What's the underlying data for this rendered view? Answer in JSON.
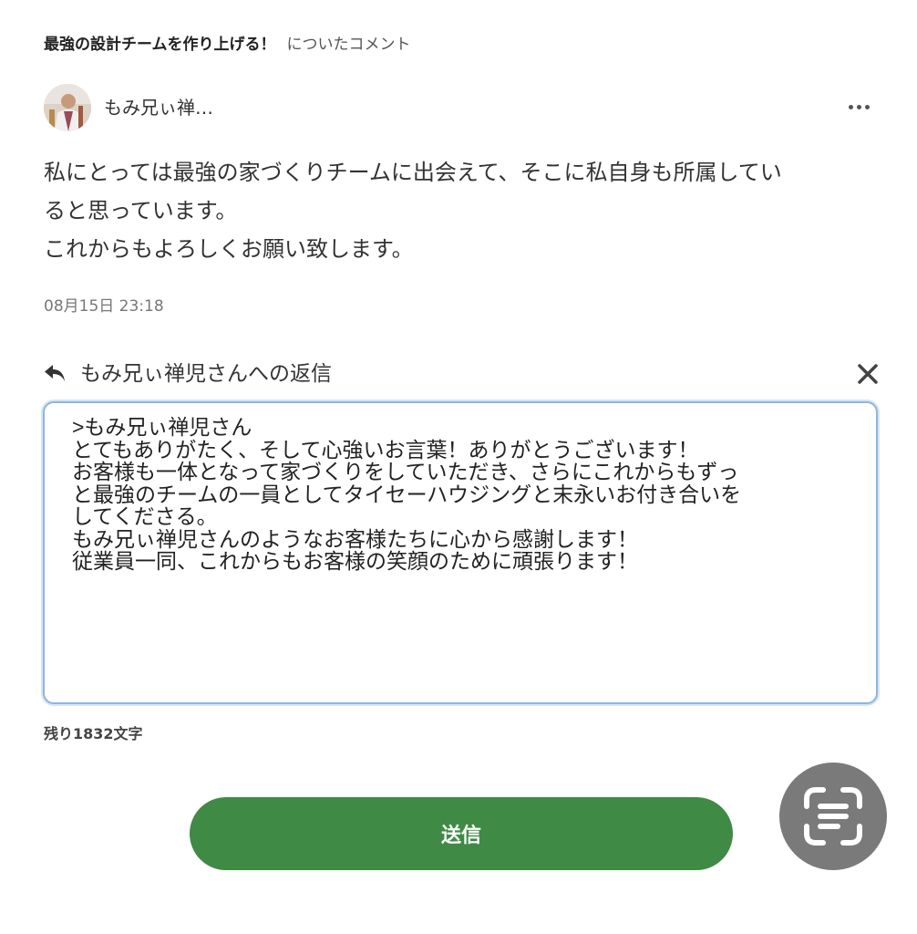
{
  "header": {
    "article_title": "最強の設計チームを作り上げる！",
    "about_comment": "についたコメント"
  },
  "comment": {
    "author_name": "もみ兄ぃ禅…",
    "avatar_icon": "user-avatar-photo",
    "more_icon": "more-horizontal-icon",
    "body_lines": [
      "私にとっては最強の家づくりチームに出会えて、そこに私自身も所属してい",
      "ると思っています。",
      "これからもよろしくお願い致します。"
    ],
    "timestamp": "08月15日 23:18"
  },
  "reply": {
    "reply_icon": "reply-arrow-icon",
    "target_label": "もみ兄ぃ禅児さんへの返信",
    "close_icon": "close-icon",
    "text_lines": [
      ">もみ兄ぃ禅児さん",
      "とてもありがたく、そして心強いお言葉！ありがとうございます！",
      "お客様も一体となって家づくりをしていただき、さらにこれからもずっ",
      "と最強のチームの一員としてタイセーハウジングと末永いお付き合いを",
      "してくださる。",
      "もみ兄ぃ禅児さんのようなお客様たちに心から感謝します！",
      "従業員一同、これからもお客様の笑顔のために頑張ります！"
    ],
    "remaining_chars": "残り1832文字",
    "send_label": "送信"
  },
  "floating": {
    "scan_icon": "text-scan-icon"
  },
  "colors": {
    "send_button": "#3f8a44",
    "textarea_border": "#8fb5df",
    "scan_button": "#7a7a7a"
  }
}
